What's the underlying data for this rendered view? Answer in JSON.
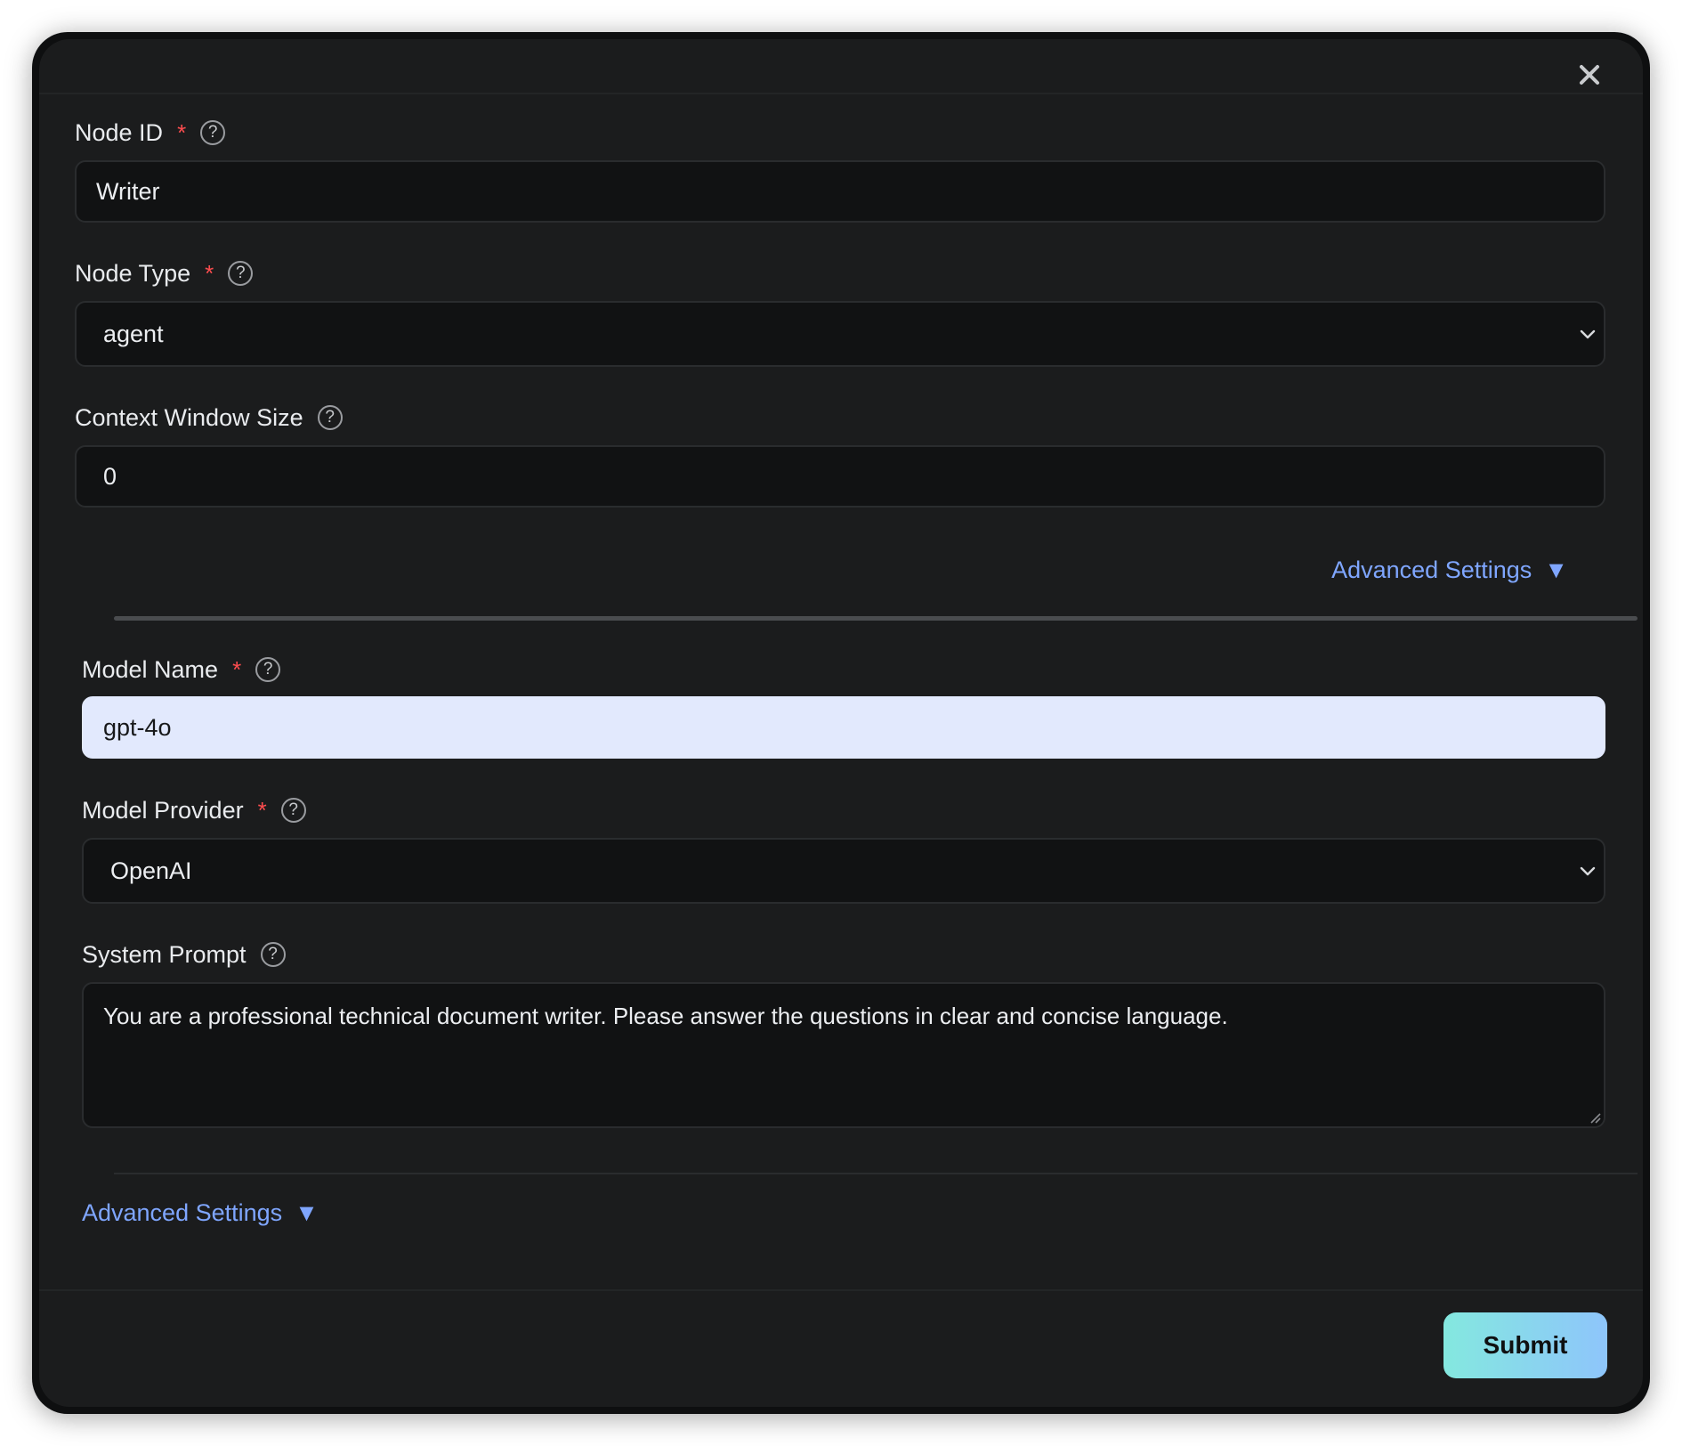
{
  "form": {
    "node_id": {
      "label": "Node ID",
      "required_mark": "*",
      "help": "?",
      "value": "Writer"
    },
    "node_type": {
      "label": "Node Type",
      "required_mark": "*",
      "help": "?",
      "value": "agent"
    },
    "context_window": {
      "label": "Context Window Size",
      "help": "?",
      "value": "0"
    },
    "advanced_settings_top": {
      "label": "Advanced Settings",
      "indicator": "▼"
    },
    "model_name": {
      "label": "Model Name",
      "required_mark": "*",
      "help": "?",
      "value": "gpt-4o"
    },
    "model_provider": {
      "label": "Model Provider",
      "required_mark": "*",
      "help": "?",
      "value": "OpenAI"
    },
    "system_prompt": {
      "label": "System Prompt",
      "help": "?",
      "value": "You are a professional technical document writer. Please answer the questions in clear and concise language."
    },
    "advanced_settings_bottom": {
      "label": "Advanced Settings",
      "indicator": "▼"
    }
  },
  "footer": {
    "submit_label": "Submit"
  },
  "colors": {
    "link": "#7fa6ff",
    "required": "#ff4d4f",
    "submit_gradient_start": "#84e8df",
    "submit_gradient_end": "#8ec5fb",
    "highlight_input": "#e2e9fd"
  },
  "icons": {
    "close": "close-icon",
    "help": "help-circle-icon",
    "dropdown": "chevron-down-icon",
    "expand": "triangle-down-icon",
    "resize": "resize-grip-icon"
  }
}
